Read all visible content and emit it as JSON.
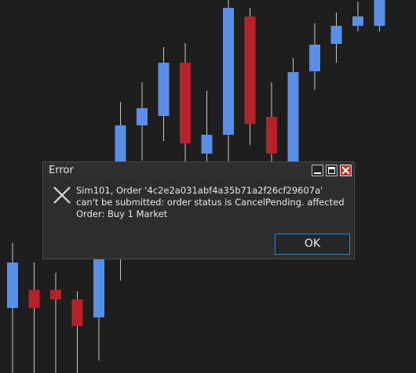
{
  "chart_data": {
    "type": "candlestick",
    "up_color": "#5b8fe6",
    "down_color": "#b52229",
    "background": "#1e1e1e",
    "candles": [
      {
        "open": 393,
        "close": 335,
        "high": 310,
        "low": 476
      },
      {
        "open": 370,
        "close": 393,
        "high": 335,
        "low": 476
      },
      {
        "open": 370,
        "close": 382,
        "high": 348,
        "low": 476
      },
      {
        "open": 382,
        "close": 416,
        "high": 372,
        "low": 476
      },
      {
        "open": 405,
        "close": 310,
        "high": 290,
        "low": 460
      },
      {
        "open": 240,
        "close": 160,
        "high": 130,
        "low": 358
      },
      {
        "open": 160,
        "close": 138,
        "high": 105,
        "low": 205
      },
      {
        "open": 148,
        "close": 80,
        "high": 60,
        "low": 180
      },
      {
        "open": 80,
        "close": 183,
        "high": 55,
        "low": 212
      },
      {
        "open": 196,
        "close": 172,
        "high": 116,
        "low": 212
      },
      {
        "open": 172,
        "close": 10,
        "high": 0,
        "low": 206
      },
      {
        "open": 21,
        "close": 158,
        "high": 10,
        "low": 185
      },
      {
        "open": 149,
        "close": 196,
        "high": 105,
        "low": 210
      },
      {
        "open": 210,
        "close": 92,
        "high": 74,
        "low": 215
      },
      {
        "open": 91,
        "close": 57,
        "high": 30,
        "low": 115
      },
      {
        "open": 56,
        "close": 33,
        "high": 16,
        "low": 80
      },
      {
        "open": 33,
        "close": 21,
        "high": 2,
        "low": 40
      },
      {
        "open": 33,
        "close": 0,
        "high": 0,
        "low": 40
      }
    ]
  },
  "dialog": {
    "title": "Error",
    "message": "Sim101, Order '4c2e2a031abf4a35b71a2f26cf29607a' can't be submitted: order status is CancelPending. affected Order: Buy 1 Market",
    "ok_label": "OK",
    "icon": "error-x-icon",
    "window_buttons": [
      "minimize-icon",
      "maximize-icon",
      "close-icon"
    ]
  }
}
